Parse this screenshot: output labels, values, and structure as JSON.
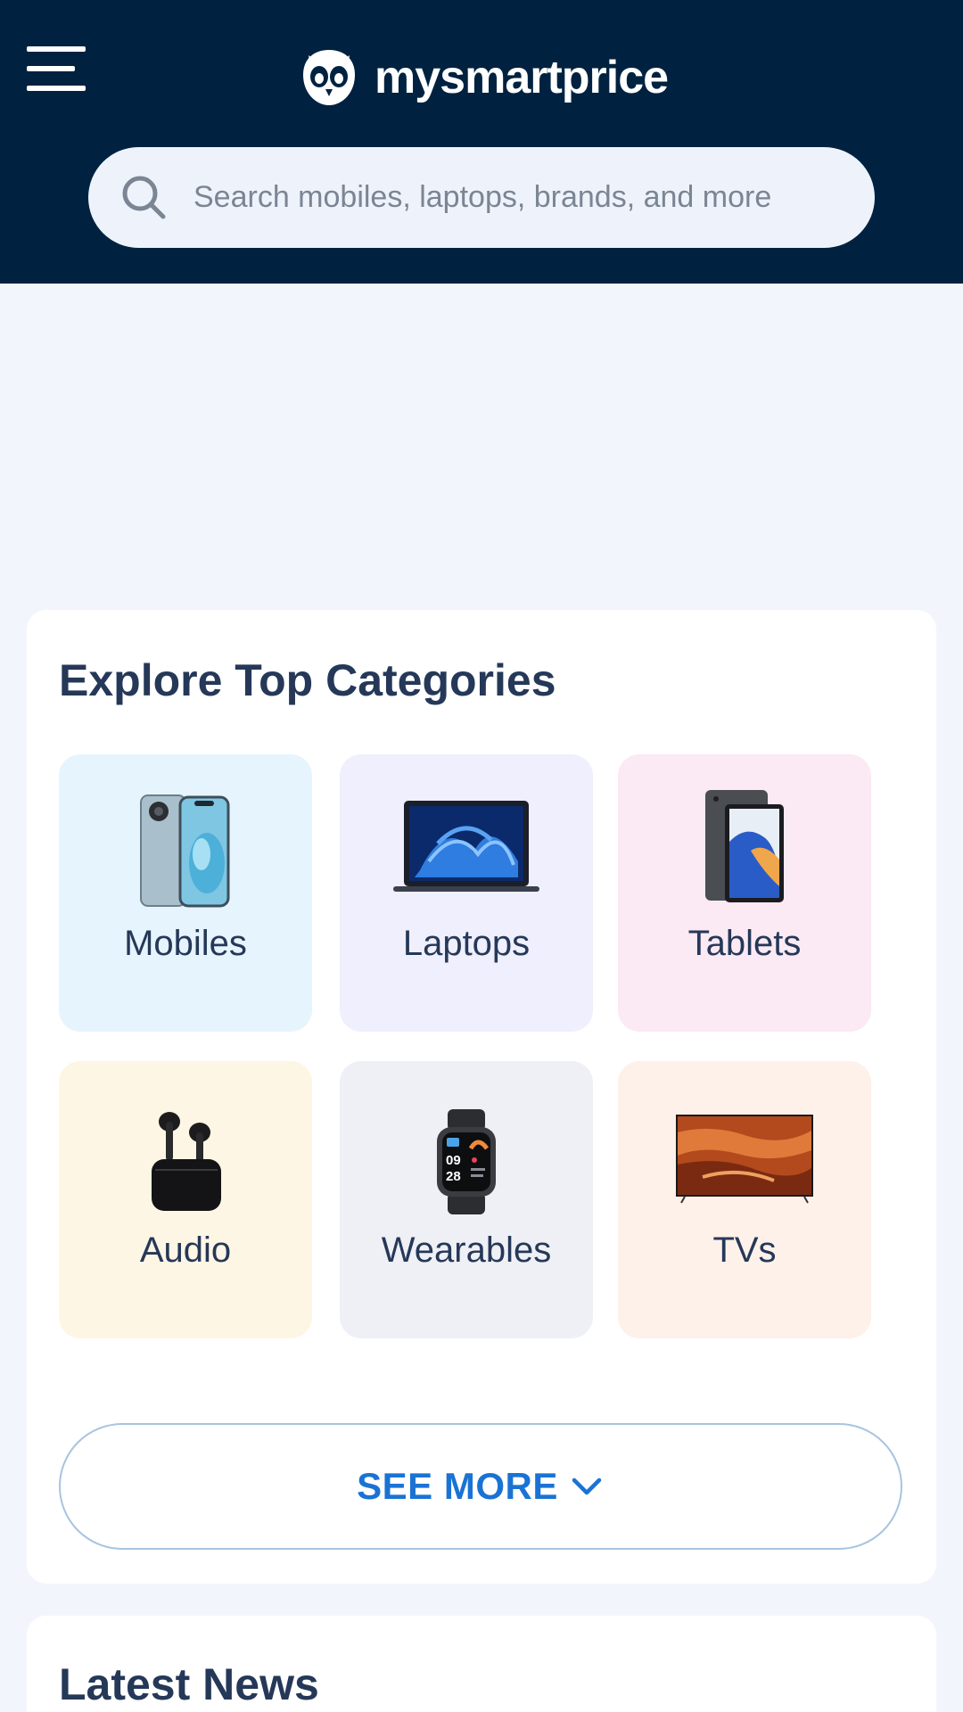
{
  "header": {
    "brand": "mysmartprice",
    "menu_icon": "hamburger-menu-icon",
    "logo_icon": "owl-logo-icon",
    "background": "#002240"
  },
  "search": {
    "placeholder": "Search mobiles, laptops, brands, and more",
    "icon": "search-icon"
  },
  "categories": {
    "title": "Explore Top Categories",
    "items": [
      {
        "label": "Mobiles",
        "icon": "smartphone-icon",
        "bg": "#e6f4fd"
      },
      {
        "label": "Laptops",
        "icon": "laptop-icon",
        "bg": "#efeffd"
      },
      {
        "label": "Tablets",
        "icon": "tablet-icon",
        "bg": "#fbe9f4"
      },
      {
        "label": "Audio",
        "icon": "earbuds-icon",
        "bg": "#fef6e4"
      },
      {
        "label": "Wearables",
        "icon": "smartwatch-icon",
        "bg": "#eff0f5"
      },
      {
        "label": "TVs",
        "icon": "television-icon",
        "bg": "#fef1ea"
      }
    ],
    "see_more_label": "SEE MORE"
  },
  "news": {
    "title": "Latest News"
  },
  "colors": {
    "page_bg": "#f2f6fc",
    "accent": "#1a73d4",
    "heading": "#253858"
  }
}
